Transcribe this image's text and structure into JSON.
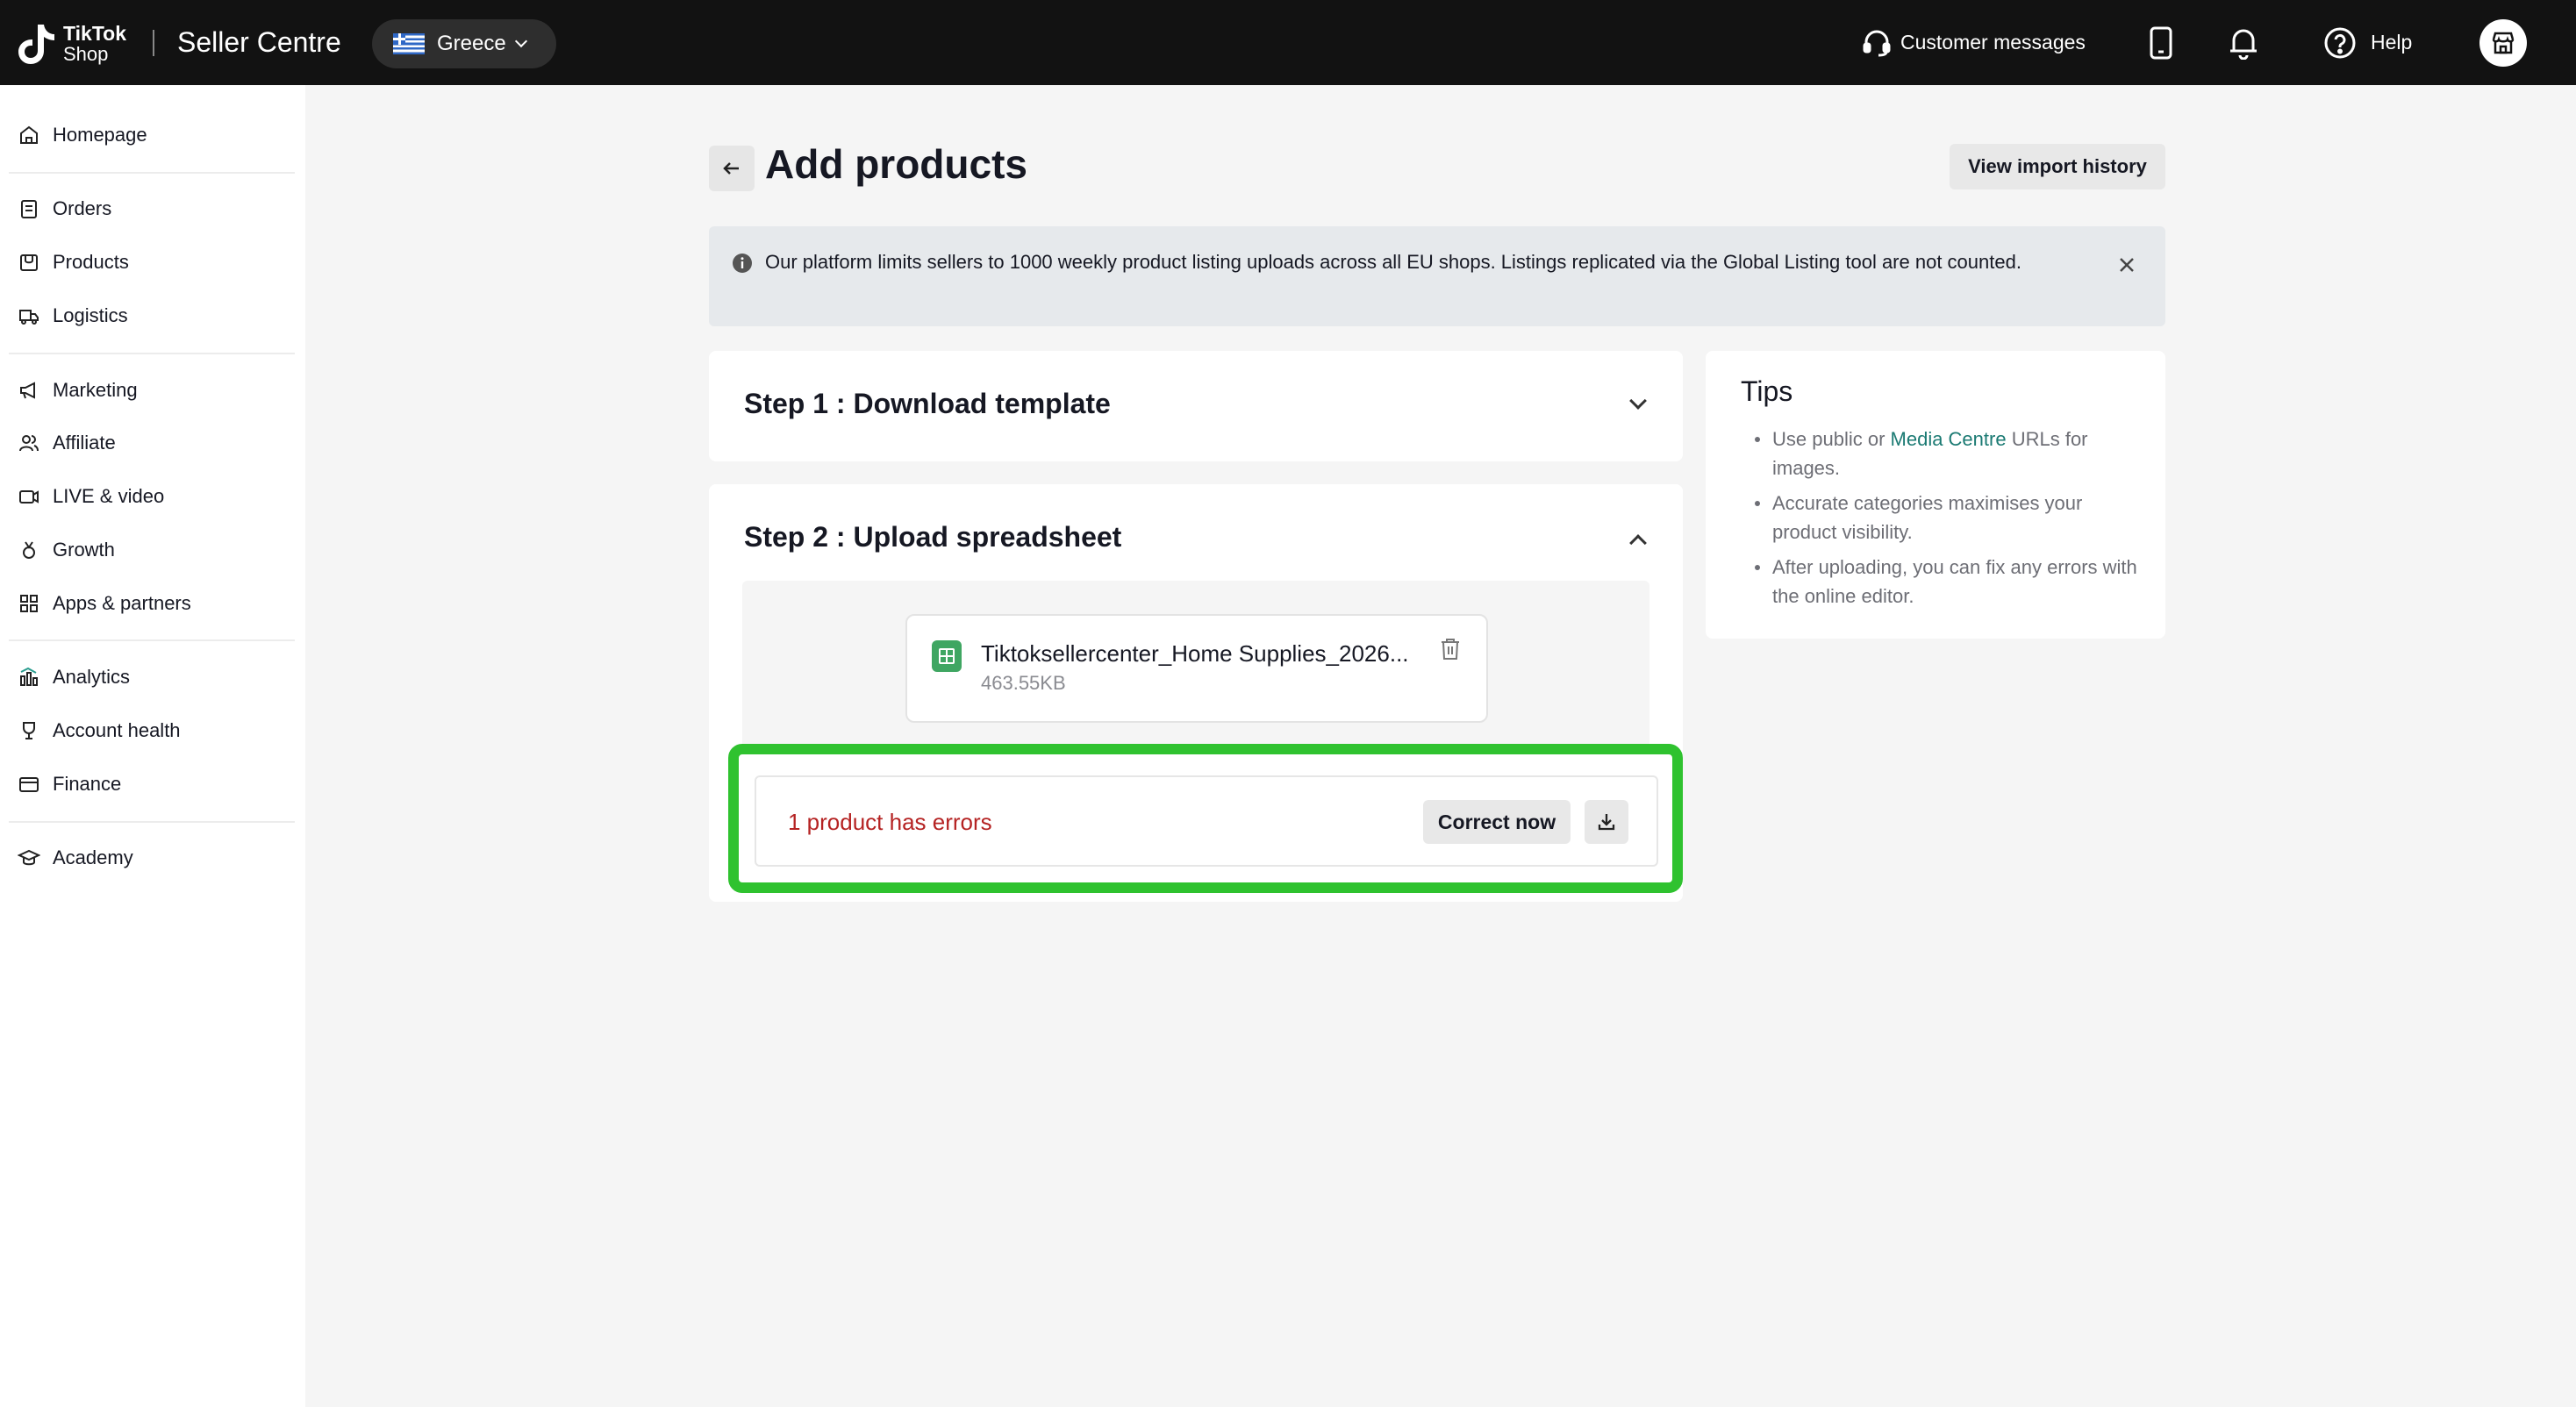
{
  "header": {
    "logo_line1": "TikTok",
    "logo_line2": "Shop",
    "app_title": "Seller Centre",
    "region": "Greece",
    "customer_messages": "Customer messages",
    "help": "Help"
  },
  "sidebar": {
    "items": [
      {
        "label": "Homepage",
        "icon": "home-icon"
      },
      {
        "label": "Orders",
        "icon": "orders-icon"
      },
      {
        "label": "Products",
        "icon": "products-icon"
      },
      {
        "label": "Logistics",
        "icon": "truck-icon"
      },
      {
        "label": "Marketing",
        "icon": "megaphone-icon"
      },
      {
        "label": "Affiliate",
        "icon": "users-icon"
      },
      {
        "label": "LIVE & video",
        "icon": "video-icon"
      },
      {
        "label": "Growth",
        "icon": "medal-icon"
      },
      {
        "label": "Apps & partners",
        "icon": "apps-icon"
      },
      {
        "label": "Analytics",
        "icon": "chart-icon"
      },
      {
        "label": "Account health",
        "icon": "trophy-icon"
      },
      {
        "label": "Finance",
        "icon": "wallet-icon"
      },
      {
        "label": "Academy",
        "icon": "graduation-icon"
      }
    ]
  },
  "main": {
    "title": "Add products",
    "view_import_history": "View import history",
    "banner_text": "Our platform limits sellers to 1000 weekly product listing uploads across all EU shops. Listings replicated via the Global Listing tool are not counted.",
    "step1_title": "Step 1 : Download template",
    "step2_title": "Step 2 : Upload spreadsheet",
    "file_name": "Tiktoksellercenter_Home Supplies_2026...",
    "file_size": "463.55KB",
    "error_text": "1 product has errors",
    "correct_now": "Correct now"
  },
  "tips": {
    "title": "Tips",
    "tip1_before": "Use public or ",
    "tip1_link": "Media Centre",
    "tip1_after": " URLs for images.",
    "tip2": "Accurate categories maximises your product visibility.",
    "tip3": "After uploading, you can fix any errors with the online editor."
  },
  "colors": {
    "topbar": "#121212",
    "error": "#b52323",
    "highlight": "#2fc22f",
    "link": "#1b7a73"
  }
}
